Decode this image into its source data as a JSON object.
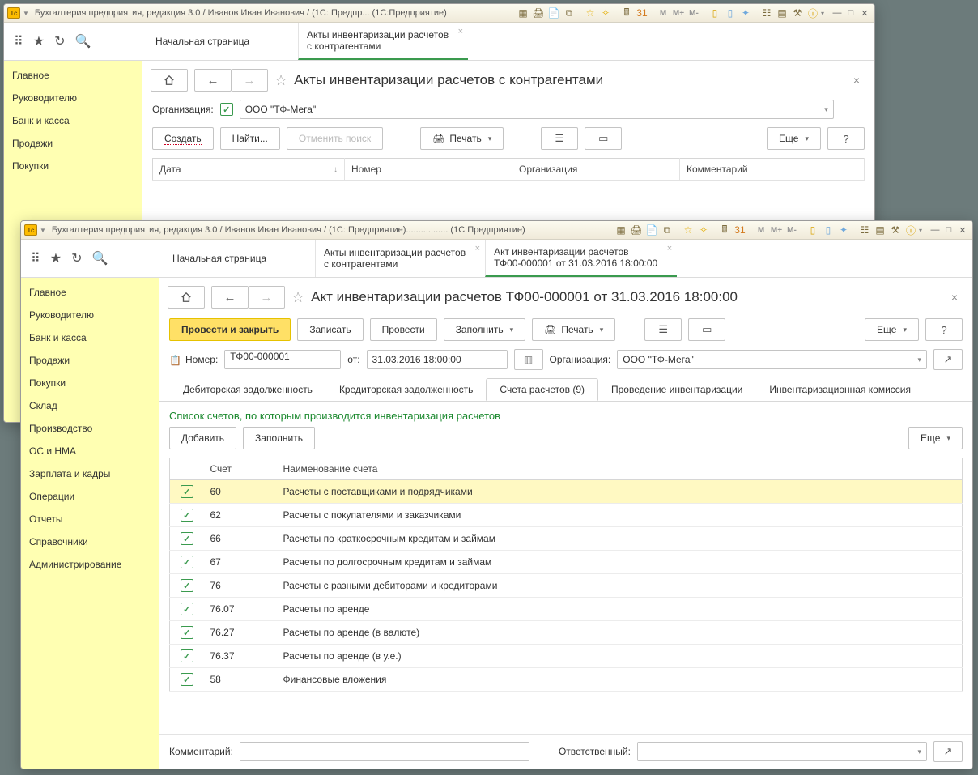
{
  "win1": {
    "title": "Бухгалтерия предприятия, редакция 3.0 / Иванов Иван Иванович / (1С: Предпр...   (1С:Предприятие)",
    "tabs": {
      "home": "Начальная страница",
      "acts_l1": "Акты инвентаризации расчетов",
      "acts_l2": "с контрагентами"
    },
    "sidebar": [
      "Главное",
      "Руководителю",
      "Банк и касса",
      "Продажи",
      "Покупки"
    ],
    "page": {
      "title": "Акты инвентаризации расчетов с контрагентами",
      "org_label": "Организация:",
      "org_value": "ООО \"ТФ-Мега\"",
      "create": "Создать",
      "find": "Найти...",
      "cancel_find": "Отменить поиск",
      "print": "Печать",
      "more": "Еще",
      "help": "?",
      "cols": {
        "date": "Дата",
        "number": "Номер",
        "org": "Организация",
        "comment": "Комментарий"
      }
    }
  },
  "win2": {
    "title": "Бухгалтерия предприятия, редакция 3.0 / Иванов Иван Иванович / (1С: Предприятие).................   (1С:Предприятие)",
    "tabs": {
      "home": "Начальная страница",
      "acts_l1": "Акты инвентаризации расчетов",
      "acts_l2": "с контрагентами",
      "doc_l1": "Акт инвентаризации расчетов",
      "doc_l2": "ТФ00-000001 от 31.03.2016 18:00:00"
    },
    "sidebar": [
      "Главное",
      "Руководителю",
      "Банк и касса",
      "Продажи",
      "Покупки",
      "Склад",
      "Производство",
      "ОС и НМА",
      "Зарплата и кадры",
      "Операции",
      "Отчеты",
      "Справочники",
      "Администрирование"
    ],
    "page": {
      "title": "Акт инвентаризации расчетов ТФ00-000001 от 31.03.2016 18:00:00",
      "post_close": "Провести и закрыть",
      "write": "Записать",
      "post": "Провести",
      "fill": "Заполнить",
      "print": "Печать",
      "more": "Еще",
      "help": "?",
      "number_label": "Номер:",
      "number_value": "ТФ00-000001",
      "from_label": "от:",
      "date_value": "31.03.2016 18:00:00",
      "org_label": "Организация:",
      "org_value": "ООО \"ТФ-Мега\"",
      "doc_tabs": {
        "deb": "Дебиторская задолженность",
        "cred": "Кредиторская задолженность",
        "acc": "Счета расчетов (9)",
        "inv": "Проведение инвентаризации",
        "comm": "Инвентаризационная комиссия"
      },
      "section_title": "Список счетов, по которым производится инвентаризация расчетов",
      "add": "Добавить",
      "fill2": "Заполнить",
      "more2": "Еще",
      "grid_cols": {
        "acc": "Счет",
        "name": "Наименование счета"
      },
      "rows": [
        {
          "acc": "60",
          "name": "Расчеты с поставщиками и подрядчиками",
          "active": true
        },
        {
          "acc": "62",
          "name": "Расчеты с покупателями и заказчиками"
        },
        {
          "acc": "66",
          "name": "Расчеты по краткосрочным кредитам и займам"
        },
        {
          "acc": "67",
          "name": "Расчеты по долгосрочным кредитам и займам"
        },
        {
          "acc": "76",
          "name": "Расчеты с разными дебиторами и кредиторами"
        },
        {
          "acc": "76.07",
          "name": "Расчеты по аренде"
        },
        {
          "acc": "76.27",
          "name": "Расчеты по аренде (в валюте)"
        },
        {
          "acc": "76.37",
          "name": "Расчеты по аренде (в у.е.)"
        },
        {
          "acc": "58",
          "name": "Финансовые вложения"
        }
      ],
      "comment_label": "Комментарий:",
      "resp_label": "Ответственный:"
    }
  },
  "tb_icons": [
    "M",
    "M+",
    "M-"
  ]
}
